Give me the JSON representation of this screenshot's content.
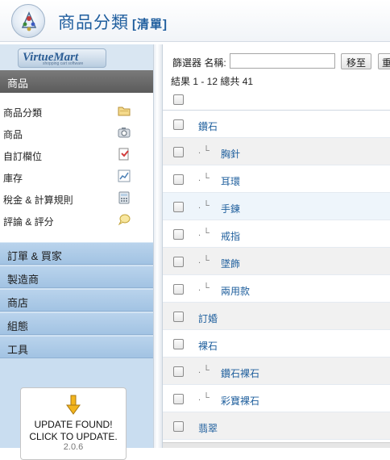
{
  "header": {
    "title": "商品分類",
    "subtitle": "[清單]"
  },
  "sidebar": {
    "logo_text": "VirtueMart",
    "logo_tagline": "shopping cart software",
    "active_section": "商品",
    "submenu": [
      {
        "label": "商品分類",
        "icon": "folder-icon"
      },
      {
        "label": "商品",
        "icon": "camera-icon"
      },
      {
        "label": "自訂欄位",
        "icon": "custom-fields-icon"
      },
      {
        "label": "庫存",
        "icon": "chart-icon"
      },
      {
        "label": "稅金 & 計算規則",
        "icon": "calculator-icon"
      },
      {
        "label": "評論 & 評分",
        "icon": "speech-bubble-icon"
      }
    ],
    "sections": [
      "訂單 & 買家",
      "製造商",
      "商店",
      "組態",
      "工具"
    ],
    "update": {
      "line1": "UPDATE FOUND!",
      "line2": "CLICK TO UPDATE.",
      "version": "2.0.6"
    }
  },
  "main": {
    "filter_label": "篩選器 名稱:",
    "filter_value": "",
    "go_button": "移至",
    "reset_button": "重",
    "result_text": "結果 1 - 12 總共 41",
    "tree_marker": ". └",
    "rows": [
      {
        "name": "鑽石",
        "indent": 0
      },
      {
        "name": "胸針",
        "indent": 1
      },
      {
        "name": "耳環",
        "indent": 1
      },
      {
        "name": "手鍊",
        "indent": 1
      },
      {
        "name": "戒指",
        "indent": 1
      },
      {
        "name": "墜飾",
        "indent": 1
      },
      {
        "name": "兩用款",
        "indent": 1
      },
      {
        "name": "訂婚",
        "indent": 0
      },
      {
        "name": "裸石",
        "indent": 0
      },
      {
        "name": "鑽石裸石",
        "indent": 1
      },
      {
        "name": "彩寶裸石",
        "indent": 1
      },
      {
        "name": "翡翠",
        "indent": 0
      }
    ]
  },
  "colors": {
    "accent": "#1f5e9e",
    "sidebar_bg": "#c9ddf0",
    "active_section_bg": "#666666"
  }
}
